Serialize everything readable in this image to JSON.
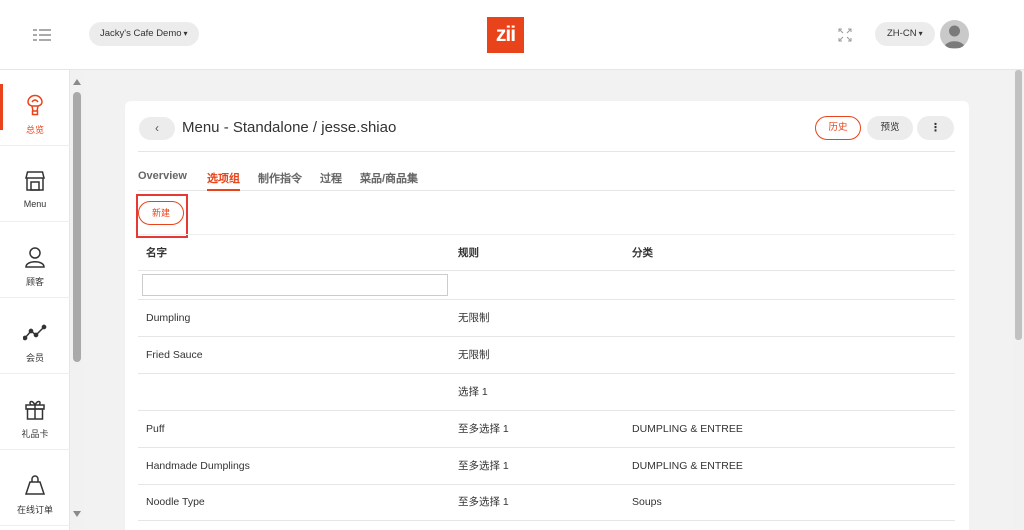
{
  "header": {
    "store": "Jacky's Cafe Demo",
    "logo": "zii",
    "language": "ZH-CN"
  },
  "sidebar": {
    "items": [
      {
        "label": "总览",
        "icon": "balloon-icon",
        "active": true
      },
      {
        "label": "Menu",
        "icon": "storefront-icon",
        "active": false
      },
      {
        "label": "顾客",
        "icon": "user-icon",
        "active": false
      },
      {
        "label": "会员",
        "icon": "trend-chart-icon",
        "active": false
      },
      {
        "label": "礼品卡",
        "icon": "gift-icon",
        "active": false
      },
      {
        "label": "在线订单",
        "icon": "shopping-bag-icon",
        "active": false
      }
    ]
  },
  "page": {
    "back": "‹",
    "title": "Menu - Standalone / jesse.shiao",
    "history_label": "历史",
    "preview_label": "预览",
    "more_label": "⋮",
    "tabs": [
      "Overview",
      "选项组",
      "制作指令",
      "过程",
      "菜品/商品集"
    ],
    "active_tab": "选项组",
    "new_label": "新建"
  },
  "table": {
    "headers": {
      "name": "名字",
      "rule": "规则",
      "category": "分类"
    },
    "rows": [
      {
        "name": "Dumpling",
        "rule": "无限制",
        "category": ""
      },
      {
        "name": "Fried Sauce",
        "rule": "无限制",
        "category": ""
      },
      {
        "name": "",
        "rule": "选择 1",
        "category": ""
      },
      {
        "name": "Puff",
        "rule": "至多选择 1",
        "category": "DUMPLING & ENTREE"
      },
      {
        "name": "Handmade Dumplings",
        "rule": "至多选择 1",
        "category": "DUMPLING & ENTREE"
      },
      {
        "name": "Noodle Type",
        "rule": "至多选择 1",
        "category": "Soups"
      }
    ]
  },
  "colors": {
    "accent": "#e8431a",
    "highlight": "#e53935"
  }
}
